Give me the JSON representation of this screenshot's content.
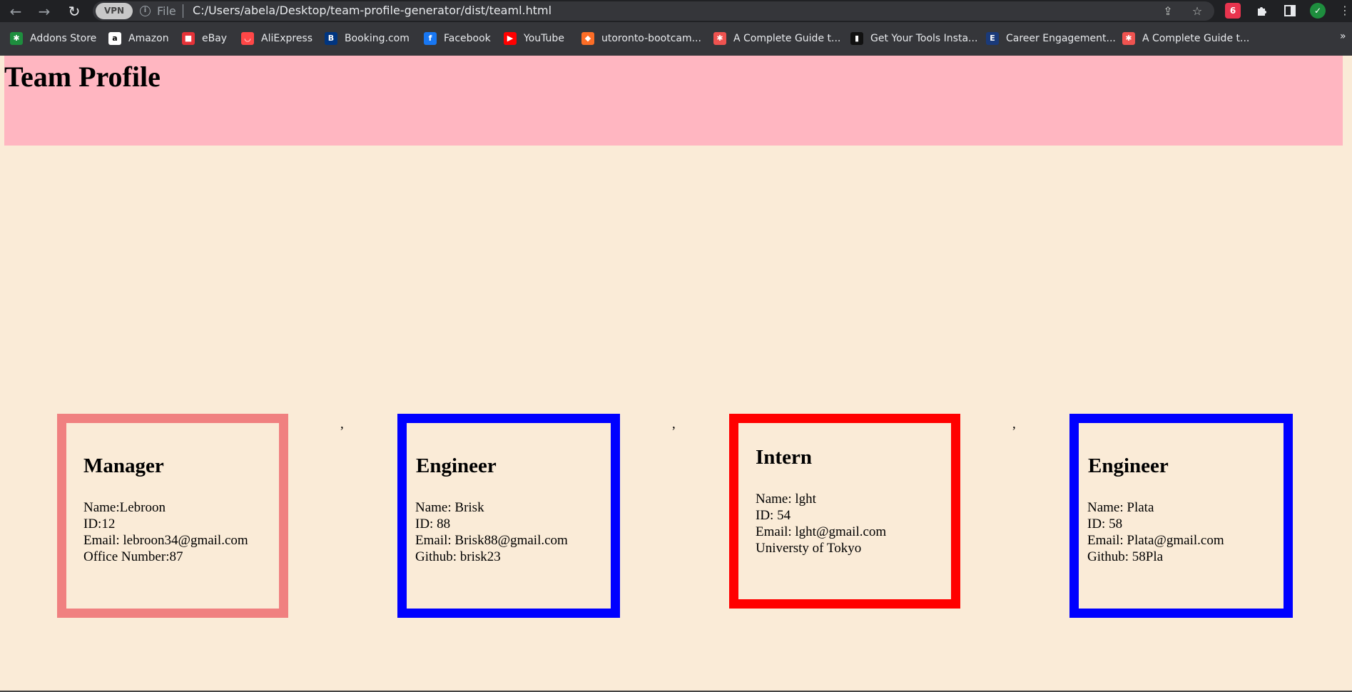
{
  "browser": {
    "vpn_label": "VPN",
    "info_glyph": "i",
    "file_label": "File",
    "url": "C:/Users/abela/Desktop/team-profile-generator/dist/teaml.html",
    "ext_badge": "6",
    "bookmarks": [
      {
        "label": "Addons Store",
        "icon": "addons-store-icon",
        "color": "#1e8e3e"
      },
      {
        "label": "Amazon",
        "icon": "amazon-icon",
        "color": "#ffffff"
      },
      {
        "label": "eBay",
        "icon": "ebay-icon",
        "color": "#e53238"
      },
      {
        "label": "AliExpress",
        "icon": "aliexpress-icon",
        "color": "#ff4747"
      },
      {
        "label": "Booking.com",
        "icon": "booking-icon",
        "color": "#003580"
      },
      {
        "label": "Facebook",
        "icon": "facebook-icon",
        "color": "#1877f2"
      },
      {
        "label": "YouTube",
        "icon": "youtube-icon",
        "color": "#ff0000"
      },
      {
        "label": "utoronto-bootcam...",
        "icon": "gitlab-icon",
        "color": "#fc6d26"
      },
      {
        "label": "A Complete Guide t...",
        "icon": "asterisk-icon",
        "color": "#ef5350"
      },
      {
        "label": "Get Your Tools Insta...",
        "icon": "notebook-icon",
        "color": "#111111"
      },
      {
        "label": "Career Engagement...",
        "icon": "career-icon",
        "color": "#1a3a7a"
      },
      {
        "label": "A Complete Guide t...",
        "icon": "asterisk-icon",
        "color": "#ef5350"
      }
    ],
    "bookmarks_more": "»"
  },
  "page": {
    "title": "Team Profile",
    "separator": ","
  },
  "cards": [
    {
      "role": "Manager",
      "border_color": "#f08080",
      "lines": [
        "Name:Lebroon",
        "ID:12",
        "Email: lebroon34@gmail.com",
        "Office Number:87"
      ]
    },
    {
      "role": "Engineer",
      "border_color": "#0000ff",
      "lines": [
        "Name: Brisk",
        "ID: 88",
        "Email: Brisk88@gmail.com",
        "Github: brisk23"
      ]
    },
    {
      "role": "Intern",
      "border_color": "#ff0000",
      "lines": [
        "Name: lght",
        "ID: 54",
        "Email: lght@gmail.com",
        "Universty of Tokyo"
      ]
    },
    {
      "role": "Engineer",
      "border_color": "#0000ff",
      "lines": [
        "Name: Plata",
        "ID: 58",
        "Email: Plata@gmail.com",
        "Github: 58Pla"
      ]
    }
  ]
}
